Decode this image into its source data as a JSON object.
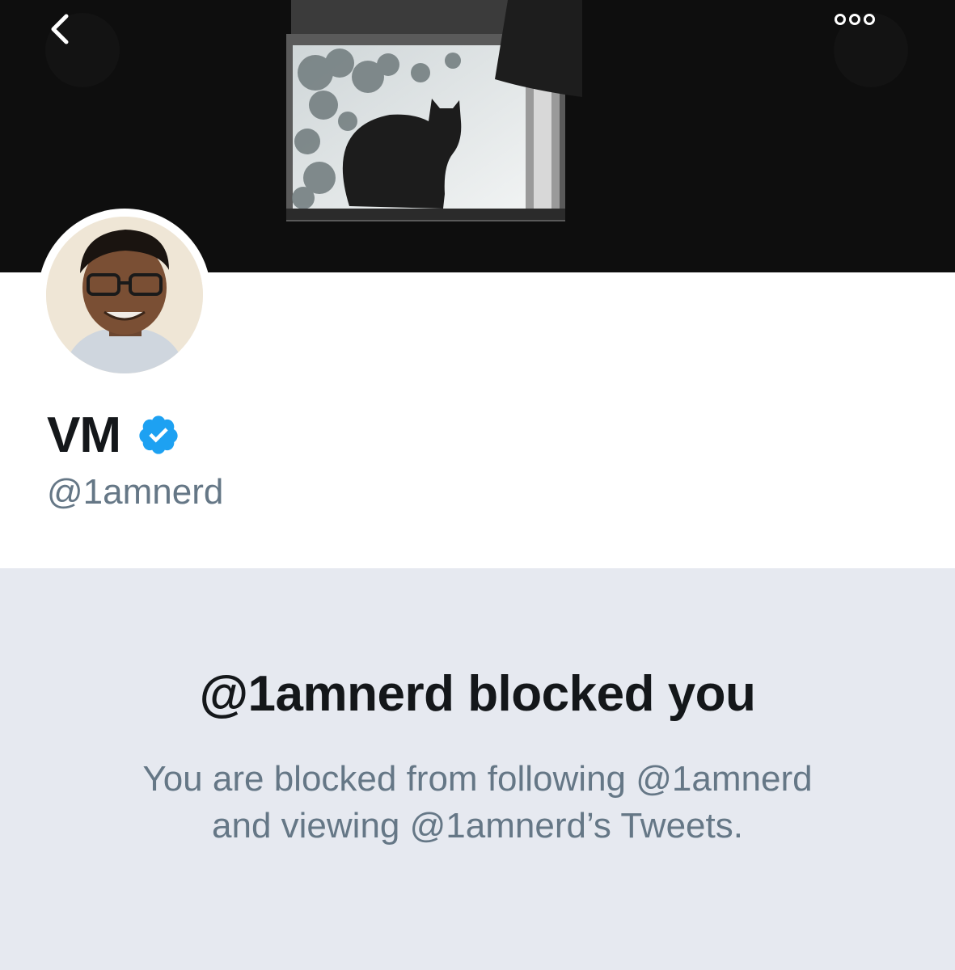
{
  "header": {
    "back_icon": "chevron-left-icon",
    "more_icon": "more-horizontal-icon"
  },
  "profile": {
    "display_name": "VM",
    "verified_icon": "verified-badge-icon",
    "handle": "@1amnerd",
    "colors": {
      "verified": "#1da1f2",
      "name": "#14171a",
      "handle": "#657786"
    }
  },
  "blocked": {
    "title": "@1amnerd blocked you",
    "line1": "You are blocked from following @1amnerd",
    "line2": "and viewing @1amnerd’s Tweets.",
    "background": "#e6e9f0"
  }
}
